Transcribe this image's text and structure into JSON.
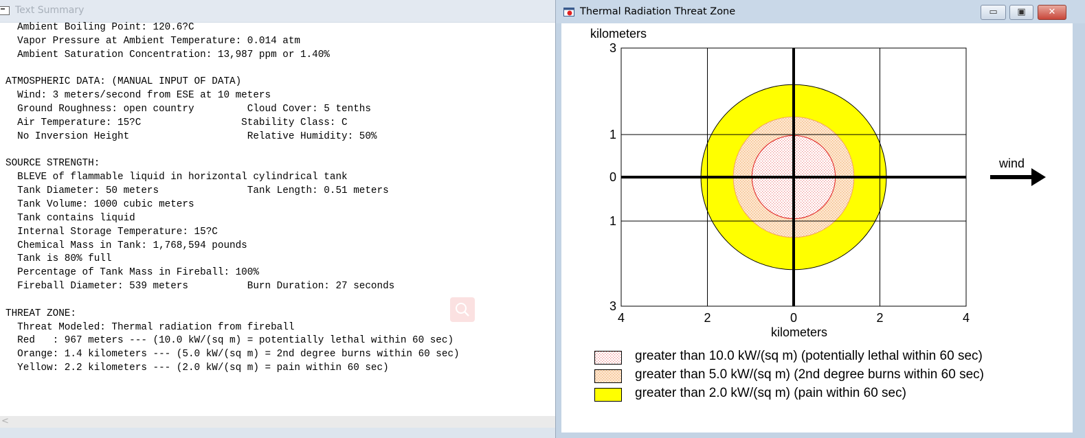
{
  "summary_window": {
    "title": "Text Summary",
    "lines": [
      "  Ambient Boiling Point: 120.6?C",
      "  Vapor Pressure at Ambient Temperature: 0.014 atm",
      "  Ambient Saturation Concentration: 13,987 ppm or 1.40%",
      "",
      "ATMOSPHERIC DATA: (MANUAL INPUT OF DATA)",
      "  Wind: 3 meters/second from ESE at 10 meters",
      "  Ground Roughness: open country         Cloud Cover: 5 tenths",
      "  Air Temperature: 15?C                 Stability Class: C",
      "  No Inversion Height                    Relative Humidity: 50%",
      "",
      "SOURCE STRENGTH:",
      "  BLEVE of flammable liquid in horizontal cylindrical tank",
      "  Tank Diameter: 50 meters               Tank Length: 0.51 meters",
      "  Tank Volume: 1000 cubic meters",
      "  Tank contains liquid",
      "  Internal Storage Temperature: 15?C",
      "  Chemical Mass in Tank: 1,768,594 pounds",
      "  Tank is 80% full",
      "  Percentage of Tank Mass in Fireball: 100%",
      "  Fireball Diameter: 539 meters          Burn Duration: 27 seconds",
      "",
      "THREAT ZONE:",
      "  Threat Modeled: Thermal radiation from fireball",
      "  Red   : 967 meters --- (10.0 kW/(sq m) = potentially lethal within 60 sec)",
      "  Orange: 1.4 kilometers --- (5.0 kW/(sq m) = 2nd degree burns within 60 sec)",
      "  Yellow: 2.2 kilometers --- (2.0 kW/(sq m) = pain within 60 sec)"
    ],
    "scroll_arrow": "<",
    "search_icon": "search-icon"
  },
  "threat_window": {
    "title": "Thermal Radiation Threat Zone",
    "buttons": {
      "minimize": "▭",
      "maximize": "▣",
      "close": "✕"
    }
  },
  "chart_data": {
    "type": "area",
    "ylabel": "kilometers",
    "xlabel": "kilometers",
    "x_ticks": [
      "4",
      "2",
      "0",
      "2",
      "4"
    ],
    "x_tick_values": [
      -4,
      -2,
      0,
      2,
      4
    ],
    "y_ticks": [
      "3",
      "1",
      "0",
      "1",
      "3"
    ],
    "y_tick_values": [
      3,
      1,
      0,
      -1,
      -3
    ],
    "xlim": [
      -4,
      4
    ],
    "ylim": [
      -3,
      3
    ],
    "grid": true,
    "wind_label": "wind",
    "wind_direction": "right",
    "zones": [
      {
        "name": "Yellow",
        "radius_km": 2.15,
        "color": "#ffff00"
      },
      {
        "name": "Orange",
        "radius_km": 1.4,
        "color": "#fbd9b4"
      },
      {
        "name": "Red",
        "radius_km": 0.967,
        "color": "#ffffff"
      }
    ],
    "legend": [
      {
        "label": "greater than 10.0 kW/(sq m) (potentially lethal within 60 sec)",
        "color": "#fde2e2"
      },
      {
        "label": "greater than 5.0 kW/(sq m) (2nd degree burns within 60 sec)",
        "color": "#fbd9b4"
      },
      {
        "label": "greater than 2.0 kW/(sq m) (pain within 60 sec)",
        "color": "#ffff00"
      }
    ]
  }
}
